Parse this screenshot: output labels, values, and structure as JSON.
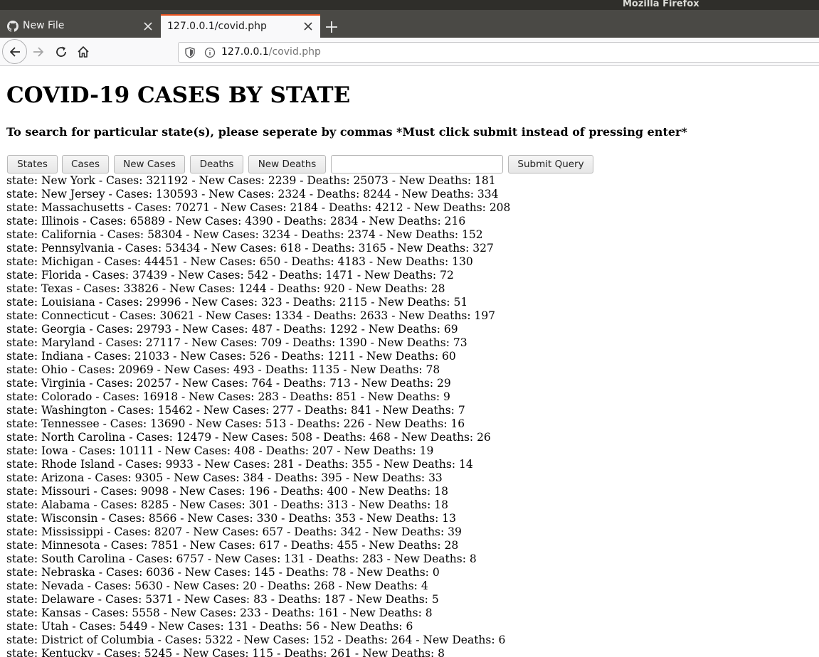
{
  "window": {
    "title": "Mozilla Firefox"
  },
  "tabs": [
    {
      "label": "New File",
      "icon": "github-icon",
      "active": false
    },
    {
      "label": "127.0.0.1/covid.php",
      "active": true
    }
  ],
  "urlbar": {
    "host": "127.0.0.1",
    "path": "/covid.php"
  },
  "page": {
    "heading": "COVID-19 CASES BY STATE",
    "instructions": "To search for particular state(s), please seperate by commas *Must click submit instead of pressing enter*",
    "buttons": {
      "states": "States",
      "cases": "Cases",
      "new_cases": "New Cases",
      "deaths": "Deaths",
      "new_deaths": "New Deaths",
      "submit": "Submit Query"
    },
    "search": {
      "value": "",
      "placeholder": ""
    },
    "rows": [
      "state: New York - Cases: 321192 - New Cases: 2239 - Deaths: 25073 - New Deaths: 181",
      "state: New Jersey - Cases: 130593 - New Cases: 2324 - Deaths: 8244 - New Deaths: 334",
      "state: Massachusetts - Cases: 70271 - New Cases: 2184 - Deaths: 4212 - New Deaths: 208",
      "state: Illinois - Cases: 65889 - New Cases: 4390 - Deaths: 2834 - New Deaths: 216",
      "state: California - Cases: 58304 - New Cases: 3234 - Deaths: 2374 - New Deaths: 152",
      "state: Pennsylvania - Cases: 53434 - New Cases: 618 - Deaths: 3165 - New Deaths: 327",
      "state: Michigan - Cases: 44451 - New Cases: 650 - Deaths: 4183 - New Deaths: 130",
      "state: Florida - Cases: 37439 - New Cases: 542 - Deaths: 1471 - New Deaths: 72",
      "state: Texas - Cases: 33826 - New Cases: 1244 - Deaths: 920 - New Deaths: 28",
      "state: Louisiana - Cases: 29996 - New Cases: 323 - Deaths: 2115 - New Deaths: 51",
      "state: Connecticut - Cases: 30621 - New Cases: 1334 - Deaths: 2633 - New Deaths: 197",
      "state: Georgia - Cases: 29793 - New Cases: 487 - Deaths: 1292 - New Deaths: 69",
      "state: Maryland - Cases: 27117 - New Cases: 709 - Deaths: 1390 - New Deaths: 73",
      "state: Indiana - Cases: 21033 - New Cases: 526 - Deaths: 1211 - New Deaths: 60",
      "state: Ohio - Cases: 20969 - New Cases: 493 - Deaths: 1135 - New Deaths: 78",
      "state: Virginia - Cases: 20257 - New Cases: 764 - Deaths: 713 - New Deaths: 29",
      "state: Colorado - Cases: 16918 - New Cases: 283 - Deaths: 851 - New Deaths: 9",
      "state: Washington - Cases: 15462 - New Cases: 277 - Deaths: 841 - New Deaths: 7",
      "state: Tennessee - Cases: 13690 - New Cases: 513 - Deaths: 226 - New Deaths: 16",
      "state: North Carolina - Cases: 12479 - New Cases: 508 - Deaths: 468 - New Deaths: 26",
      "state: Iowa - Cases: 10111 - New Cases: 408 - Deaths: 207 - New Deaths: 19",
      "state: Rhode Island - Cases: 9933 - New Cases: 281 - Deaths: 355 - New Deaths: 14",
      "state: Arizona - Cases: 9305 - New Cases: 384 - Deaths: 395 - New Deaths: 33",
      "state: Missouri - Cases: 9098 - New Cases: 196 - Deaths: 400 - New Deaths: 18",
      "state: Alabama - Cases: 8285 - New Cases: 301 - Deaths: 313 - New Deaths: 18",
      "state: Wisconsin - Cases: 8566 - New Cases: 330 - Deaths: 353 - New Deaths: 13",
      "state: Mississippi - Cases: 8207 - New Cases: 657 - Deaths: 342 - New Deaths: 39",
      "state: Minnesota - Cases: 7851 - New Cases: 617 - Deaths: 455 - New Deaths: 28",
      "state: South Carolina - Cases: 6757 - New Cases: 131 - Deaths: 283 - New Deaths: 8",
      "state: Nebraska - Cases: 6036 - New Cases: 145 - Deaths: 78 - New Deaths: 0",
      "state: Nevada - Cases: 5630 - New Cases: 20 - Deaths: 268 - New Deaths: 4",
      "state: Delaware - Cases: 5371 - New Cases: 83 - Deaths: 187 - New Deaths: 5",
      "state: Kansas - Cases: 5558 - New Cases: 233 - Deaths: 161 - New Deaths: 8",
      "state: Utah - Cases: 5449 - New Cases: 131 - Deaths: 56 - New Deaths: 6",
      "state: District of Columbia - Cases: 5322 - New Cases: 152 - Deaths: 264 - New Deaths: 6",
      "state: Kentucky - Cases: 5245 - New Cases: 115 - Deaths: 261 - New Deaths: 8"
    ]
  },
  "colors": {
    "titlebar": "#2f2e2a",
    "tabstrip": "#4a4945",
    "active_tab_accent": "#e95420",
    "toolbar": "#f9f9fa"
  }
}
